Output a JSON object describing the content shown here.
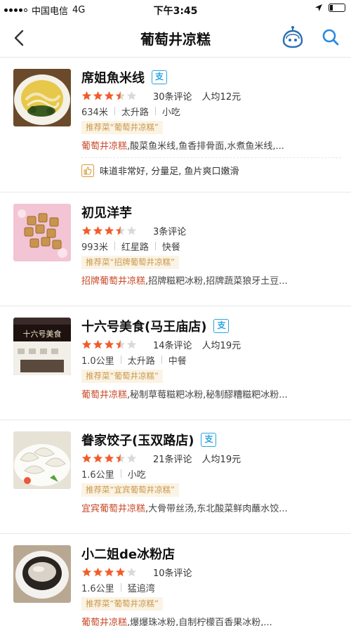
{
  "status_bar": {
    "carrier": "中国电信",
    "network": "4G",
    "time": "下午3:45"
  },
  "nav": {
    "title": "葡萄井凉糕"
  },
  "restaurants": [
    {
      "name": "席姐魚米线",
      "alipay_badge": "支",
      "rating": 3.5,
      "reviews": "30条评论",
      "avg_price": "人均12元",
      "distance": "634米",
      "area": "太升路",
      "category": "小吃",
      "recommend_tag": "推荐菜“葡萄井凉糕”",
      "dish_highlight": "葡萄井凉糕",
      "dish_rest": ",酸菜鱼米线,鱼香排骨面,水煮鱼米线,...",
      "comment": "味道非常好, 分量足, 鱼片爽口嫩滑"
    },
    {
      "name": "初见洋芋",
      "rating": 3.5,
      "reviews": "3条评论",
      "distance": "993米",
      "area": "红星路",
      "category": "快餐",
      "recommend_tag": "推荐菜“招牌葡萄井凉糕”",
      "dish_highlight": "招牌葡萄井凉糕",
      "dish_rest": ",招牌糍粑冰粉,招牌蔬菜狼牙土豆..."
    },
    {
      "name": "十六号美食(马王庙店)",
      "alipay_badge": "支",
      "rating": 3.5,
      "reviews": "14条评论",
      "avg_price": "人均19元",
      "distance": "1.0公里",
      "area": "太升路",
      "category": "中餐",
      "recommend_tag": "推荐菜“葡萄井凉糕”",
      "dish_highlight": "葡萄井凉糕",
      "dish_rest": ",秘制草莓糍粑冰粉,秘制醪糟糍粑冰粉..."
    },
    {
      "name": "眷家饺子(玉双路店)",
      "alipay_badge": "支",
      "rating": 3.5,
      "reviews": "21条评论",
      "avg_price": "人均19元",
      "distance": "1.6公里",
      "category": "小吃",
      "recommend_tag": "推荐菜“宜宾葡萄井凉糕”",
      "dish_highlight": "宜宾葡萄井凉糕",
      "dish_rest": ",大骨带丝汤,东北酸菜鲜肉蘸水饺..."
    },
    {
      "name": "小二姐de冰粉店",
      "rating": 4,
      "reviews": "10条评论",
      "distance": "1.6公里",
      "area": "猛追湾",
      "recommend_tag": "推荐菜“葡萄井凉糕”",
      "dish_highlight": "葡萄井凉糕",
      "dish_rest": ",爆爆珠冰粉,自制柠檬百香果冰粉,..."
    }
  ],
  "colors": {
    "star": "#f25c2a",
    "star_empty": "#d9d9d9",
    "accent_blue": "#2aa3e0",
    "dish_highlight": "#c94a2a",
    "tag_text": "#c8984a",
    "tag_bg": "#fbf3e4"
  },
  "icons": [
    "back-arrow-icon",
    "robot-assistant-icon",
    "search-icon",
    "alipay-badge-icon",
    "star-icon",
    "thumbs-up-icon",
    "location-arrow-icon",
    "battery-icon",
    "signal-icon"
  ]
}
